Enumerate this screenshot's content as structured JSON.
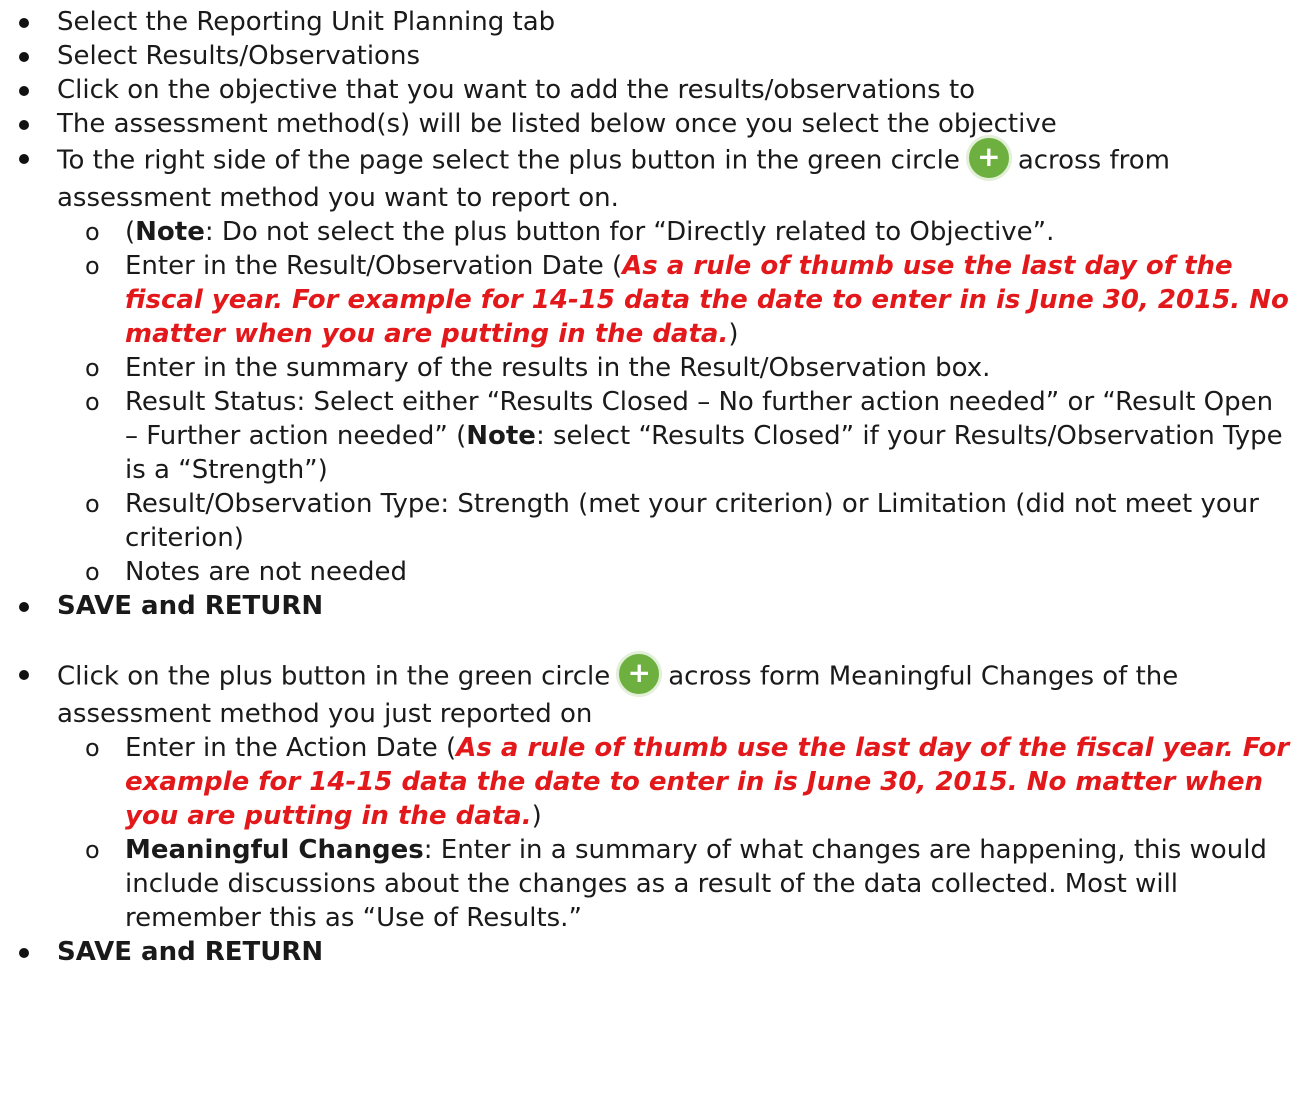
{
  "colors": {
    "emphasis_red": "#e3181b",
    "plus_green": "#6db03f"
  },
  "icons": {
    "plus": "plus-circle-icon"
  },
  "plus_glyph": "+",
  "b1": "Select the Reporting Unit Planning tab",
  "b2": "Select Results/Observations",
  "b3": "Click on the objective that you want to add the results/observations to",
  "b4": "The assessment method(s) will be listed below once you select the objective",
  "b5": {
    "pre": "To the right side of the page select the plus button in the green circle",
    "post": "across from assessment method you want to report on."
  },
  "b5s1": {
    "pre": "(",
    "note": "Note",
    "post": ": Do not select the plus button for “Directly related to Objective”."
  },
  "b5s2": {
    "pre": "Enter in the Result/Observation Date (",
    "red": "As a rule of thumb use the last day of the fiscal year.  For example for 14-15 data the date to enter in is June 30, 2015.  No matter when you are putting in the data.",
    "post": ")"
  },
  "b5s3": "Enter in the summary of the results in the Result/Observation box.",
  "b5s4": {
    "pre": "Result Status: Select either “Results Closed – No further action needed” or “Result Open – Further action needed” (",
    "note": "Note",
    "post": ": select “Results Closed” if your Results/Observation Type is a “Strength”)"
  },
  "b5s5": "Result/Observation Type: Strength (met your criterion) or Limitation (did not meet your criterion)",
  "b5s6": "Notes are not needed",
  "save1": "SAVE and RETURN",
  "b6": {
    "pre": "Click on the plus button in the green circle",
    "post": "across form Meaningful Changes of the assessment method you just reported on"
  },
  "b6s1": {
    "pre": "Enter in the Action Date (",
    "red": "As a rule of thumb use the last day of the fiscal year.  For example for 14-15 data the date to enter in is June 30, 2015.  No matter when you are putting in the data.",
    "post": ")"
  },
  "b6s2": {
    "bold": "Meaningful Changes",
    "post": ": Enter in a summary of what changes are happening, this would include discussions about the changes as a result of the data collected.  Most will remember this as “Use of Results.”"
  },
  "save2": "SAVE and RETURN"
}
